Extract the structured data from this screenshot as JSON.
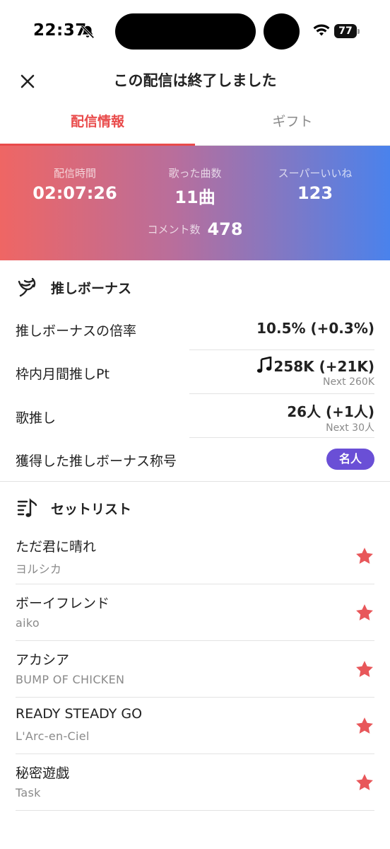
{
  "status": {
    "time": "22:37",
    "battery": "77"
  },
  "header": {
    "title": "この配信は終了しました"
  },
  "tabs": [
    {
      "label": "配信情報",
      "active": true
    },
    {
      "label": "ギフト",
      "active": false
    }
  ],
  "stats": {
    "items": [
      {
        "label": "配信時間",
        "value": "02:07:26"
      },
      {
        "label": "歌った曲数",
        "value": "11曲"
      },
      {
        "label": "スーパーいいね",
        "value": "123"
      }
    ],
    "comments": {
      "label": "コメント数",
      "value": "478"
    }
  },
  "bonus": {
    "title": "推しボーナス",
    "rows": [
      {
        "label": "推しボーナスの倍率",
        "value": "10.5% (+0.3%)",
        "sub": ""
      },
      {
        "label": "枠内月間推しPt",
        "value": "258K (+21K)",
        "sub": "Next 260K"
      },
      {
        "label": "歌推し",
        "value": "26人 (+1人)",
        "sub": "Next 30人"
      },
      {
        "label": "獲得した推しボーナス称号",
        "badge": "名人"
      }
    ]
  },
  "setlist": {
    "title": "セットリスト",
    "songs": [
      {
        "title": "ただ君に晴れ",
        "artist": "ヨルシカ"
      },
      {
        "title": "ボーイフレンド",
        "artist": "aiko"
      },
      {
        "title": "アカシア",
        "artist": "BUMP OF CHICKEN"
      },
      {
        "title": "READY STEADY GO",
        "artist": "L'Arc-en-Ciel"
      },
      {
        "title": "秘密遊戯",
        "artist": "Task"
      }
    ]
  },
  "colors": {
    "accent": "#e94b4b",
    "star": "#e8575a",
    "badge": "#6a4fd6",
    "gradient_start": "#ef6664",
    "gradient_end": "#4a82ec"
  },
  "icons": {
    "close": "close-icon",
    "bonus": "wing-icon",
    "setlist": "music-list-icon",
    "favorite": "star-icon",
    "points": "music-note-icon"
  }
}
